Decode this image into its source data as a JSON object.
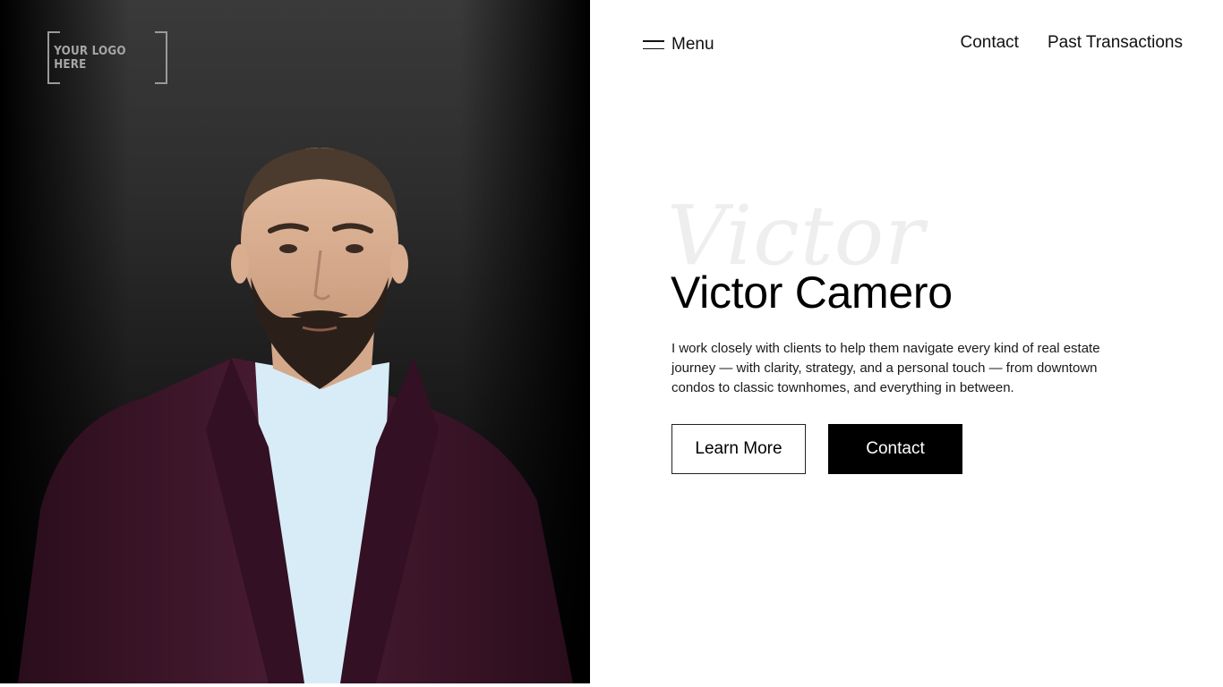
{
  "logo": {
    "text": "YOUR LOGO HERE"
  },
  "nav": {
    "menu_label": "Menu",
    "links": [
      "Contact",
      "Past Transactions"
    ]
  },
  "hero": {
    "signature": "Victor",
    "name": "Victor Camero",
    "bio": "I work closely with clients to help them navigate every kind of real estate journey — with clarity, strategy, and a personal touch — from downtown condos to classic townhomes, and everything in between.",
    "primary_button": "Learn More",
    "secondary_button": "Contact"
  },
  "icons": {
    "menu": "hamburger-icon"
  },
  "colors": {
    "accent": "#000000",
    "jacket": "#3a1526",
    "shirt": "#d8ecf7"
  }
}
